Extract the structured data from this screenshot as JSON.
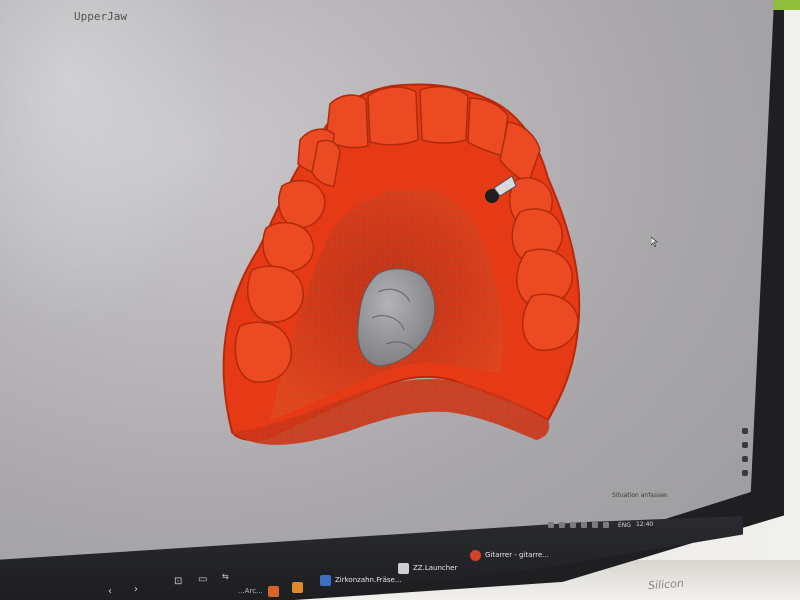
{
  "viewport": {
    "label": "UpperJaw"
  },
  "status": {
    "hint": "Situation anfassen"
  },
  "taskbar": {
    "items": [
      {
        "label": ""
      },
      {
        "label": "Zirkonzahn.Fräse..."
      },
      {
        "label": "ZZ.Launcher"
      },
      {
        "label": "Gitarrer - gitarre..."
      }
    ],
    "search_label": "...Arc...",
    "tray_lang": "ENG",
    "time": "12:40"
  },
  "colors": {
    "model": "#e63a16",
    "model_dark": "#b8280c",
    "scan_gray": "#8e8e92",
    "taskbar": "#1f2024"
  },
  "icons": [
    "back-icon",
    "forward-icon",
    "start-icon",
    "folder-icon",
    "snip-icon",
    "mouse-cursor-icon",
    "tray-icon"
  ]
}
